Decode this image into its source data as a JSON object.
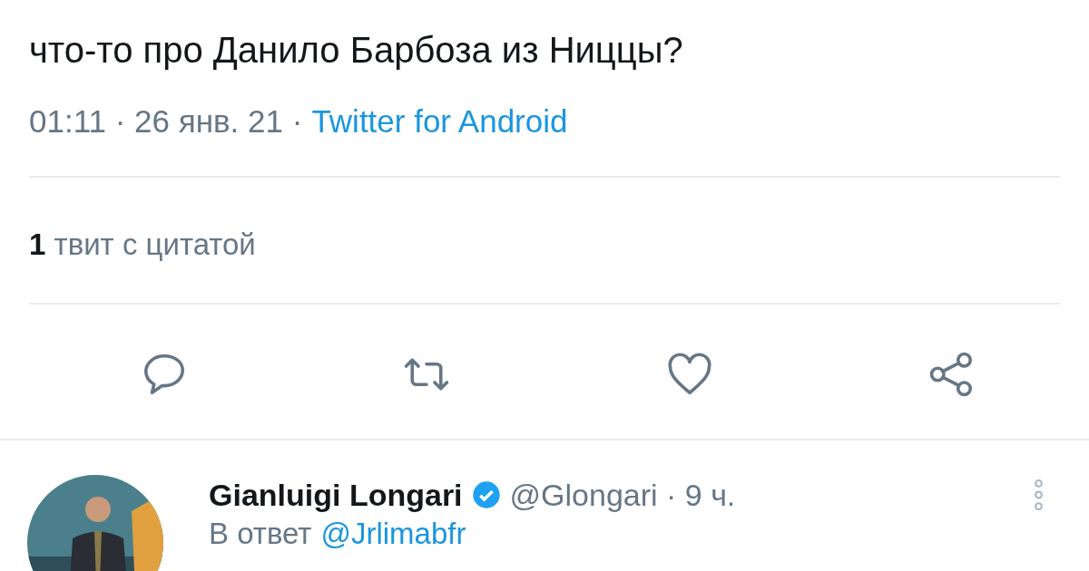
{
  "tweet": {
    "text": "что-то про Данило Барбоза из Ниццы?",
    "timestamp": "01:11 · 26 янв. 21 ·",
    "source": "Twitter for Android",
    "quotes": "**1** твит с цитатой"
  },
  "actions": [
    {
      "kind": "reply"
    },
    {
      "kind": "retweet"
    },
    {
      "kind": "like"
    },
    {
      "kind": "share"
    }
  ],
  "reply": {
    "name": "Gianluigi Longari",
    "verified": true,
    "handle": "@Glongari · 9 ч.",
    "reply_to_label": "В ответ",
    "reply_to": "@Jrlimabfr"
  }
}
